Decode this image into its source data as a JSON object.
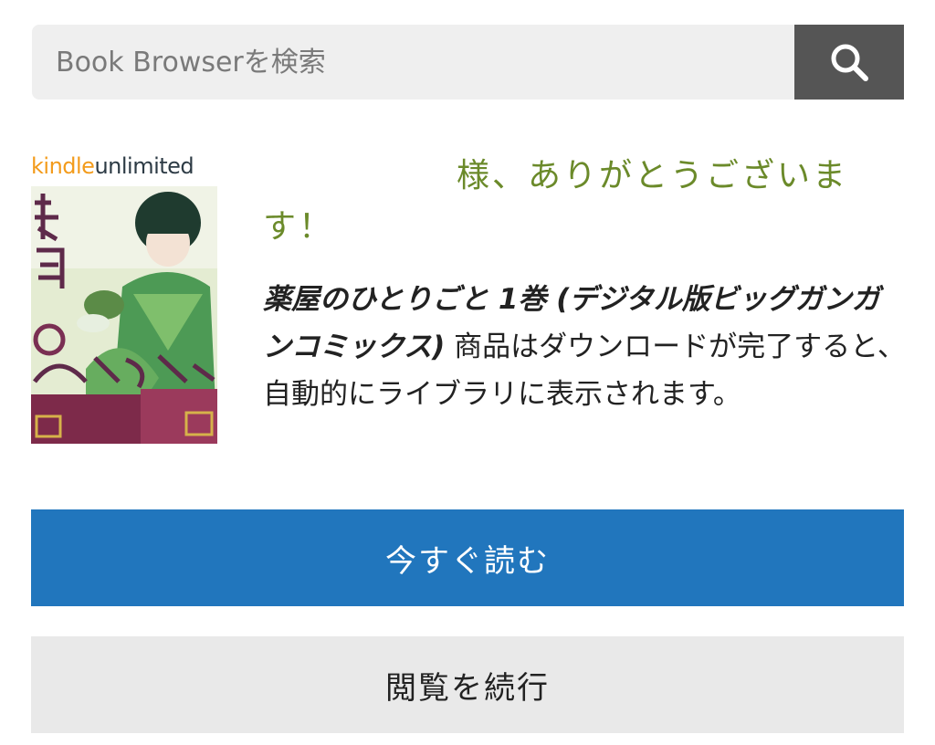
{
  "search": {
    "placeholder": "Book Browserを検索",
    "value": "",
    "button_icon": "search-icon"
  },
  "book": {
    "badge_kindle": "kindle",
    "badge_unlimited": "unlimited",
    "title": "薬屋のひとりごと 1巻 (デジタル版ビッグガンガンコミックス)"
  },
  "thanks_text": "様、ありがとうございます！",
  "message_suffix": "商品はダウンロードが完了すると、自動的にライブラリに表示されます。",
  "buttons": {
    "read_now": "今すぐ読む",
    "continue_browsing": "閲覧を続行"
  },
  "colors": {
    "primary_button": "#2176bd",
    "secondary_button": "#e9e9e9",
    "thanks_text": "#6b8a2a",
    "search_button": "#555555"
  }
}
